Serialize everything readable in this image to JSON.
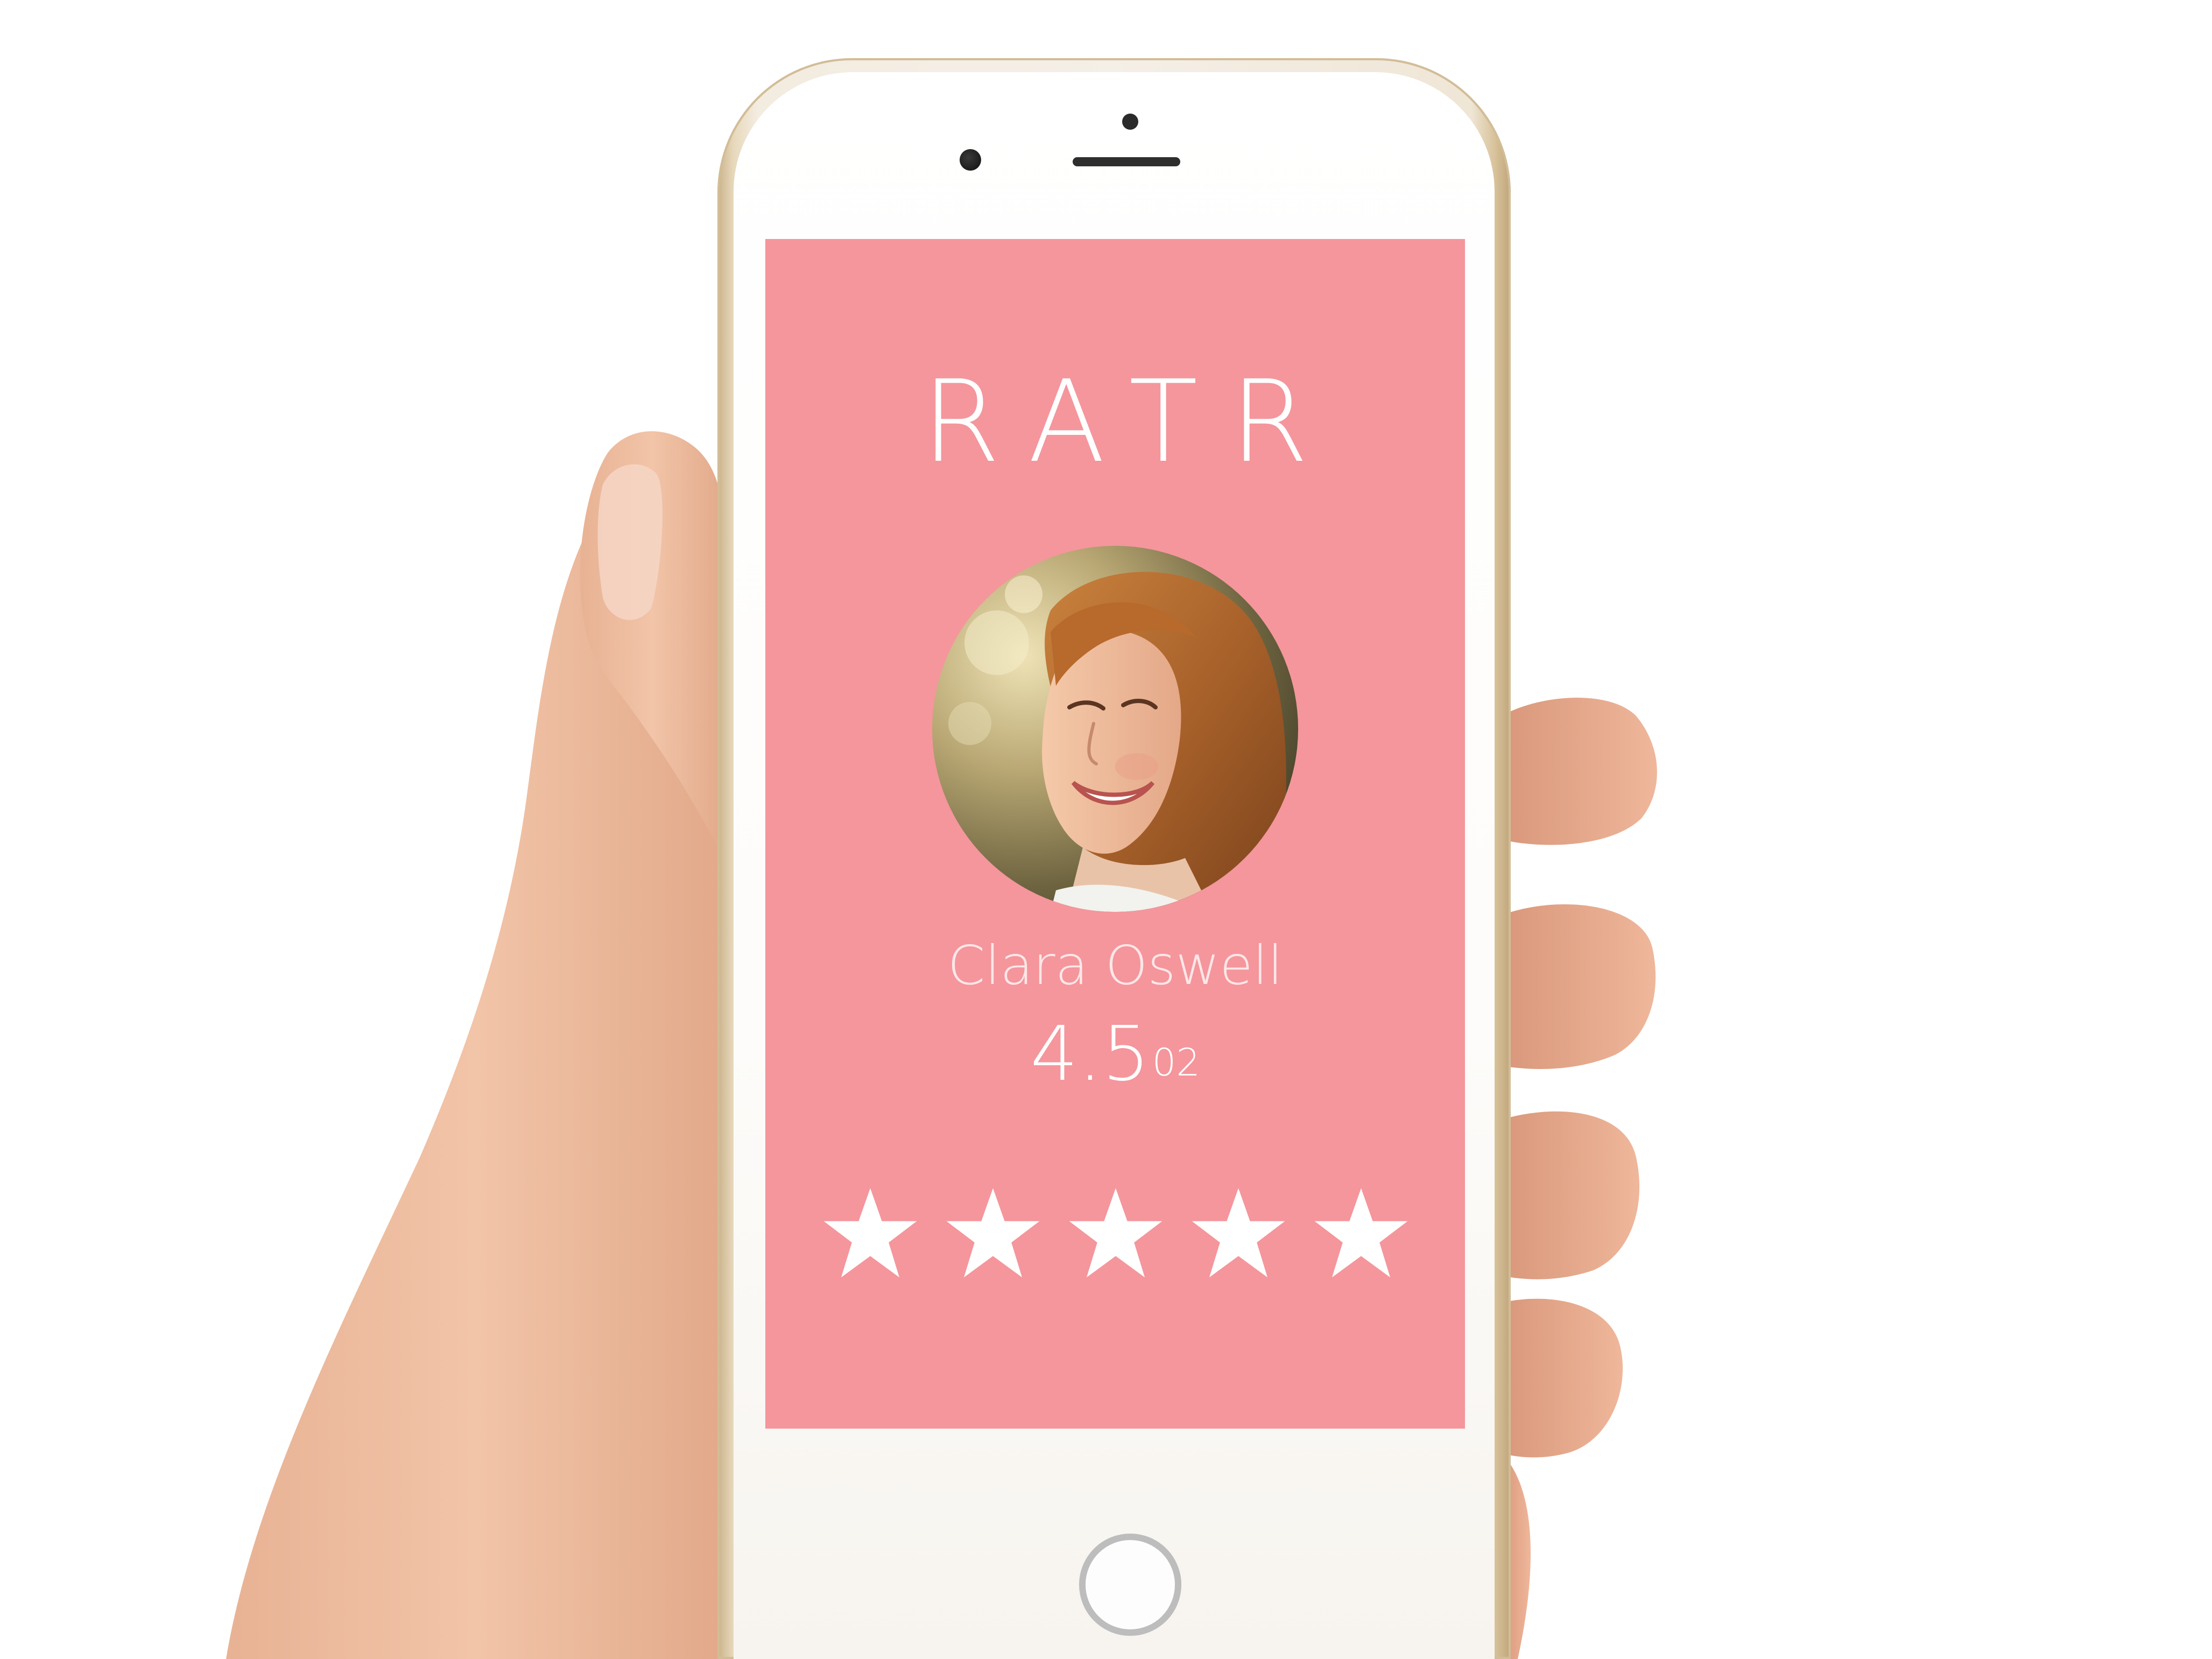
{
  "app": {
    "title": "RATR"
  },
  "profile": {
    "name": "Clara Oswell",
    "rating_value": "4.5",
    "rating_count": "02"
  },
  "stars": {
    "count": 5,
    "filled": 5,
    "icon": "star-icon",
    "color": "#ffffff"
  },
  "colors": {
    "screen_background": "#f4969c",
    "text": "#ffffff"
  }
}
